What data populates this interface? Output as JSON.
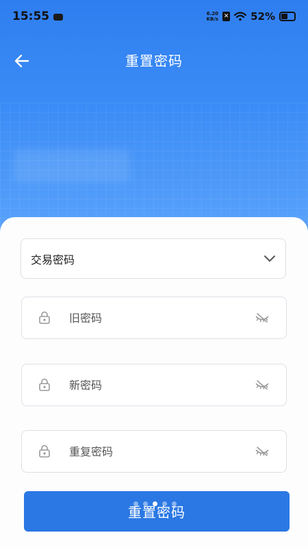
{
  "status_bar": {
    "time": "15:55",
    "net_speed_value": "6.20",
    "net_speed_unit": "KB/s",
    "battery": "52%"
  },
  "header": {
    "title": "重置密码",
    "back_icon": "arrow-left-icon"
  },
  "form": {
    "password_type": {
      "selected": "交易密码",
      "icon": "chevron-down-icon"
    },
    "fields": [
      {
        "placeholder": "旧密码",
        "lock_icon": "lock-icon",
        "eye_icon": "eye-off-icon"
      },
      {
        "placeholder": "新密码",
        "lock_icon": "lock-icon",
        "eye_icon": "eye-off-icon"
      },
      {
        "placeholder": "重复密码",
        "lock_icon": "lock-icon",
        "eye_icon": "eye-off-icon"
      }
    ],
    "submit_label": "重置密码"
  },
  "page_indicator": {
    "count": 5,
    "active_index": 2
  },
  "colors": {
    "header_blue": "#2f7ef0",
    "button_blue": "#2b78e4",
    "card_bg": "#fdfdfe",
    "border": "#dcdfe5"
  }
}
